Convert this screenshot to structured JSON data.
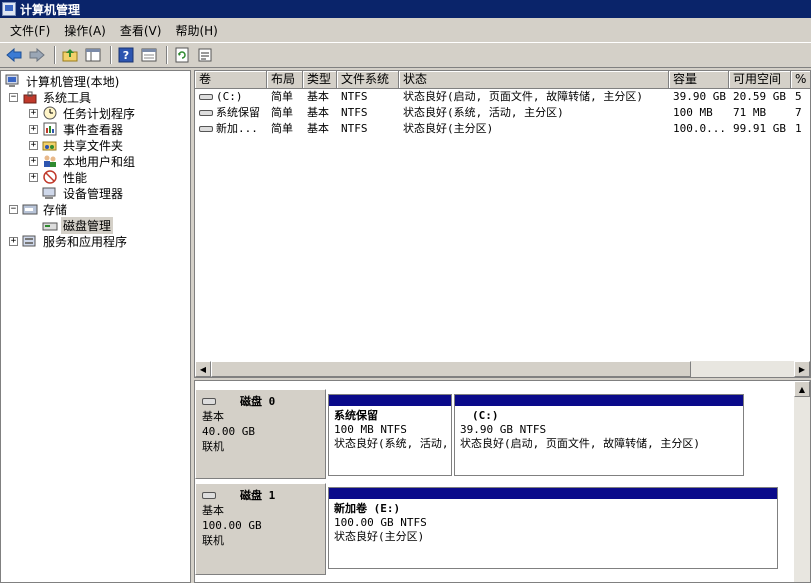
{
  "window": {
    "title": "计算机管理"
  },
  "menu": [
    "文件(F)",
    "操作(A)",
    "查看(V)",
    "帮助(H)"
  ],
  "toolbar": {
    "icons": [
      "back-arrow-icon",
      "forward-arrow-icon",
      "up-folder-icon",
      "show-hide-tree-icon",
      "help-icon",
      "export-list-icon",
      "refresh-icon",
      "properties-icon"
    ]
  },
  "tree": {
    "root": "计算机管理(本地)",
    "items": [
      {
        "label": "系统工具",
        "expander": "−",
        "icon": "toolbox-icon"
      },
      {
        "label": "任务计划程序",
        "expander": "+",
        "icon": "clock-icon"
      },
      {
        "label": "事件查看器",
        "expander": "+",
        "icon": "event-log-icon"
      },
      {
        "label": "共享文件夹",
        "expander": "+",
        "icon": "shared-folder-icon"
      },
      {
        "label": "本地用户和组",
        "expander": "+",
        "icon": "users-icon"
      },
      {
        "label": "性能",
        "expander": "+",
        "icon": "performance-icon"
      },
      {
        "label": "设备管理器",
        "expander": "",
        "icon": "device-manager-icon"
      },
      {
        "label": "存储",
        "expander": "−",
        "icon": "storage-icon"
      },
      {
        "label": "磁盘管理",
        "expander": "",
        "icon": "disk-management-icon"
      },
      {
        "label": "服务和应用程序",
        "expander": "+",
        "icon": "services-icon"
      }
    ]
  },
  "volumes": {
    "columns": [
      "卷",
      "布局",
      "类型",
      "文件系统",
      "状态",
      "容量",
      "可用空间",
      "%"
    ],
    "rows": [
      [
        "(C:)",
        "简单",
        "基本",
        "NTFS",
        "状态良好(启动, 页面文件, 故障转储, 主分区)",
        "39.90 GB",
        "20.59 GB",
        "5"
      ],
      [
        "系统保留",
        "简单",
        "基本",
        "NTFS",
        "状态良好(系统, 活动, 主分区)",
        "100 MB",
        "71 MB",
        "7"
      ],
      [
        "新加...",
        "简单",
        "基本",
        "NTFS",
        "状态良好(主分区)",
        "100.0...",
        "99.91 GB",
        "1"
      ]
    ]
  },
  "disks": [
    {
      "name": "磁盘 0",
      "type": "基本",
      "size": "40.00 GB",
      "status": "联机",
      "partitions": [
        {
          "name": "系统保留",
          "size_fs": "100 MB NTFS",
          "status": "状态良好(系统, 活动, 主分区)"
        },
        {
          "name": "(C:)",
          "size_fs": "39.90 GB NTFS",
          "status": "状态良好(启动, 页面文件, 故障转储, 主分区)"
        }
      ]
    },
    {
      "name": "磁盘 1",
      "type": "基本",
      "size": "100.00 GB",
      "status": "联机",
      "partitions": [
        {
          "name": "新加卷 (E:)",
          "size_fs": "100.00 GB NTFS",
          "status": "状态良好(主分区)"
        }
      ]
    }
  ]
}
